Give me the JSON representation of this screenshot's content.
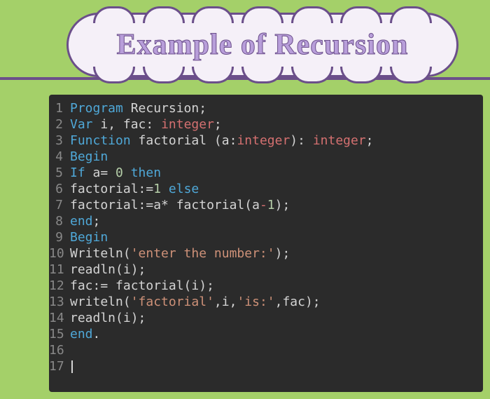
{
  "title": "Example of Recursion",
  "code": {
    "lines": [
      {
        "num": "1",
        "tokens": [
          {
            "t": "Program ",
            "c": "kw-blue"
          },
          {
            "t": "Recursion",
            "c": "ident"
          },
          {
            "t": ";",
            "c": "op"
          }
        ]
      },
      {
        "num": "2",
        "tokens": [
          {
            "t": "Var ",
            "c": "kw-blue"
          },
          {
            "t": "i, fac: ",
            "c": "ident"
          },
          {
            "t": "integer",
            "c": "kw-red"
          },
          {
            "t": ";",
            "c": "op"
          }
        ]
      },
      {
        "num": "3",
        "tokens": [
          {
            "t": "Function ",
            "c": "kw-blue"
          },
          {
            "t": "factorial (a:",
            "c": "ident"
          },
          {
            "t": "integer",
            "c": "kw-red"
          },
          {
            "t": "): ",
            "c": "ident"
          },
          {
            "t": "integer",
            "c": "kw-red"
          },
          {
            "t": ";",
            "c": "op"
          }
        ]
      },
      {
        "num": "4",
        "tokens": [
          {
            "t": "Begin",
            "c": "kw-blue"
          }
        ]
      },
      {
        "num": "5",
        "tokens": [
          {
            "t": "If ",
            "c": "kw-blue"
          },
          {
            "t": "a= ",
            "c": "ident"
          },
          {
            "t": "0",
            "c": "num"
          },
          {
            "t": " then",
            "c": "kw-blue"
          }
        ]
      },
      {
        "num": "6",
        "tokens": [
          {
            "t": "factorial:=",
            "c": "ident"
          },
          {
            "t": "1",
            "c": "num"
          },
          {
            "t": " else",
            "c": "kw-blue"
          }
        ]
      },
      {
        "num": "7",
        "tokens": [
          {
            "t": "factorial:=a* factorial(a",
            "c": "ident"
          },
          {
            "t": "-",
            "c": "kw-red"
          },
          {
            "t": "1",
            "c": "num"
          },
          {
            "t": ");",
            "c": "ident"
          }
        ]
      },
      {
        "num": "8",
        "tokens": [
          {
            "t": "end",
            "c": "kw-blue"
          },
          {
            "t": ";",
            "c": "op"
          }
        ]
      },
      {
        "num": "9",
        "tokens": [
          {
            "t": "Begin",
            "c": "kw-blue"
          }
        ]
      },
      {
        "num": "10",
        "tokens": [
          {
            "t": "Writeln(",
            "c": "ident"
          },
          {
            "t": "'enter the number:'",
            "c": "str"
          },
          {
            "t": ");",
            "c": "ident"
          }
        ]
      },
      {
        "num": "11",
        "tokens": [
          {
            "t": "readln(i);",
            "c": "ident"
          }
        ]
      },
      {
        "num": "12",
        "tokens": [
          {
            "t": "fac:= factorial(i);",
            "c": "ident"
          }
        ]
      },
      {
        "num": "13",
        "tokens": [
          {
            "t": "writeln(",
            "c": "ident"
          },
          {
            "t": "'factorial'",
            "c": "str"
          },
          {
            "t": ",i,",
            "c": "ident"
          },
          {
            "t": "'is:'",
            "c": "str"
          },
          {
            "t": ",fac);",
            "c": "ident"
          }
        ]
      },
      {
        "num": "14",
        "tokens": [
          {
            "t": "readln(i);",
            "c": "ident"
          }
        ]
      },
      {
        "num": "15",
        "tokens": [
          {
            "t": "end",
            "c": "kw-blue"
          },
          {
            "t": ".",
            "c": "op"
          }
        ]
      },
      {
        "num": "16",
        "tokens": []
      },
      {
        "num": "17",
        "tokens": [],
        "cursor": true
      }
    ]
  }
}
